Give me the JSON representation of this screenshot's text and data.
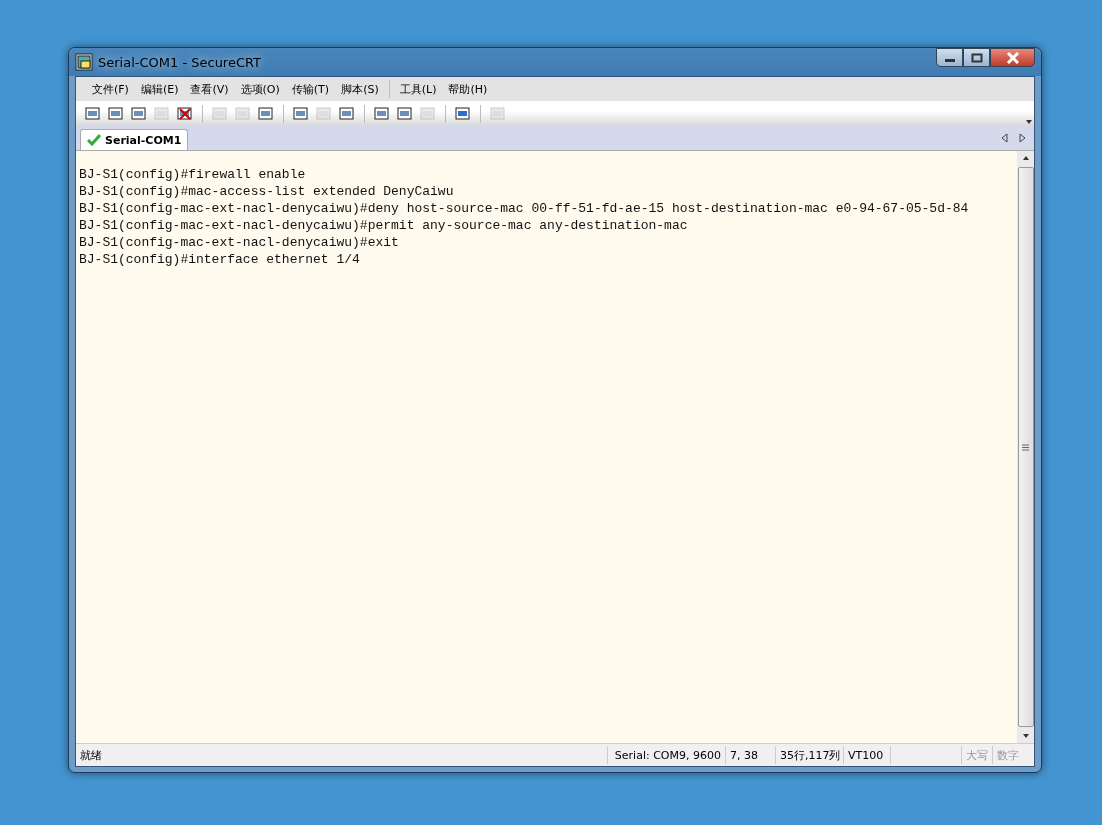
{
  "window": {
    "title": "Serial-COM1 - SecureCRT"
  },
  "menu": [
    [
      "文件(F)",
      "编辑(E)",
      "查看(V)",
      "选项(O)",
      "传输(T)",
      "脚本(S)"
    ],
    [
      "工具(L)",
      "帮助(H)"
    ]
  ],
  "toolbar": [
    [
      {
        "disabled": false
      },
      {
        "disabled": false
      },
      {
        "disabled": false
      },
      {
        "disabled": true
      },
      {
        "disabled": false
      }
    ],
    [
      {
        "disabled": true
      },
      {
        "disabled": true
      },
      {
        "disabled": false
      }
    ],
    [
      {
        "disabled": false
      },
      {
        "disabled": true
      },
      {
        "disabled": false
      }
    ],
    [
      {
        "disabled": false
      },
      {
        "disabled": false
      },
      {
        "disabled": true
      }
    ],
    [
      {
        "disabled": false
      }
    ],
    [
      {
        "disabled": true
      }
    ]
  ],
  "tabs": [
    {
      "label": "Serial-COM1",
      "selected": true,
      "connected": true
    }
  ],
  "terminal": {
    "lines": [
      "BJ-S1(config)#firewall enable",
      "BJ-S1(config)#mac-access-list extended DenyCaiwu",
      "BJ-S1(config-mac-ext-nacl-denycaiwu)#deny host-source-mac 00-ff-51-fd-ae-15 host-destination-mac e0-94-67-05-5d-84",
      "BJ-S1(config-mac-ext-nacl-denycaiwu)#permit any-source-mac any-destination-mac",
      "BJ-S1(config-mac-ext-nacl-denycaiwu)#exit",
      "BJ-S1(config)#interface ethernet 1/4"
    ]
  },
  "status_bar": {
    "message": "就绪",
    "fields": [
      {
        "text": "Serial: COM9, 9600",
        "disabled": false
      },
      {
        "text": "7,  38",
        "disabled": false
      },
      {
        "text": "35行,117列",
        "disabled": false
      },
      {
        "text": "VT100",
        "disabled": false
      },
      {
        "text": "大写",
        "disabled": true
      },
      {
        "text": "数字",
        "disabled": true
      }
    ]
  }
}
